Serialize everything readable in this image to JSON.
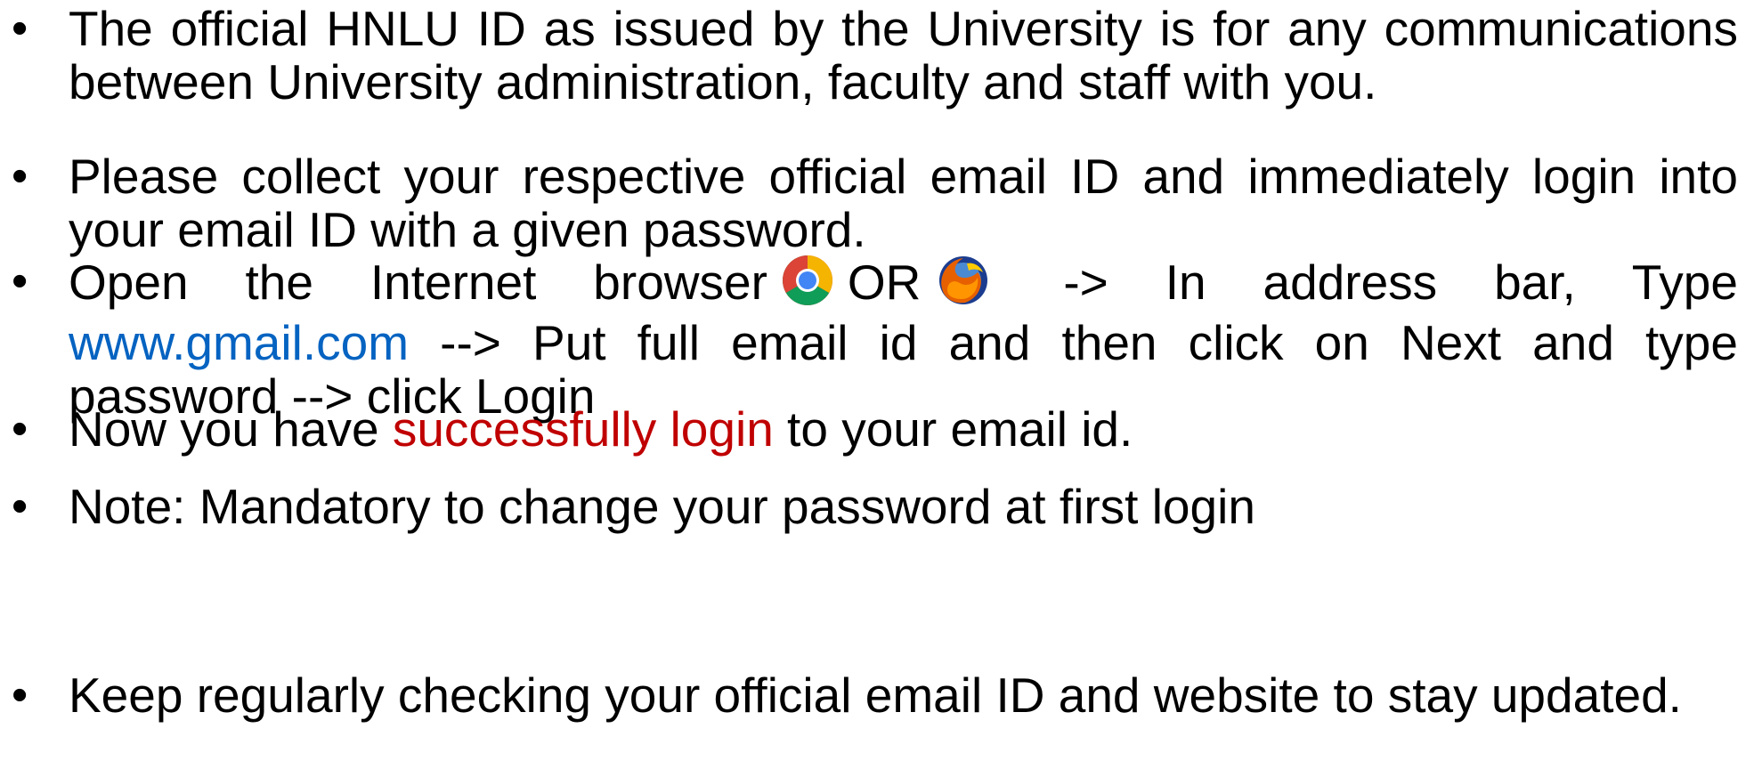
{
  "bullet_char": "•",
  "items": [
    {
      "text": "The official HNLU ID as issued by the University is for any communications between University administration, faculty and staff with you."
    },
    {
      "text": "Please collect your respective official email ID and immediately login into your email ID with a given password."
    },
    {
      "part1": "Open the Internet browser",
      "icon1": "chrome-icon",
      "or_word": "OR",
      "icon2": "firefox-icon",
      "part2": " -> In address bar, Type ",
      "link": "www.gmail.com",
      "part3": " --> Put full email id and then click on Next and  type password --> click Login"
    },
    {
      "part1": "Now you have ",
      "highlight": "successfully login",
      "part2": " to your email id."
    },
    {
      "text": "Note: Mandatory to change your password at first login"
    },
    {
      "text": "Keep regularly checking your official email ID and website to stay updated."
    }
  ],
  "colors": {
    "link": "#0563c1",
    "highlight": "#c00000",
    "text": "#000000"
  }
}
